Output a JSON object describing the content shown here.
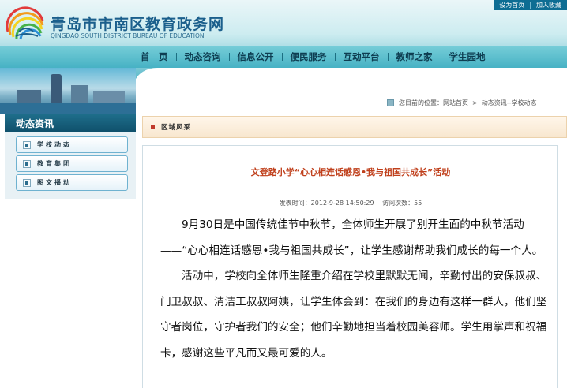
{
  "header": {
    "site_title": "青岛市市南区教育政务网",
    "site_subtitle": "QINGDAO SOUTH DISTRICT BUREAU OF EDUCATION",
    "top_links": [
      "设为首页",
      "加入收藏"
    ]
  },
  "nav": {
    "items": [
      "首　页",
      "动态咨询",
      "信息公开",
      "便民服务",
      "互动平台",
      "教师之家",
      "学生园地"
    ]
  },
  "sidebar": {
    "title": "动态资讯",
    "items": [
      "学校动态",
      "教育集团",
      "图文播动"
    ]
  },
  "breadcrumb": {
    "prefix": "您目前的位置：",
    "home": "网站首页",
    "separator": ">",
    "current": "动态资讯--学校动态"
  },
  "section": {
    "label": "区域风采"
  },
  "article": {
    "title": "文登路小学“心心相连话感恩•我与祖国共成长”活动",
    "published": "发表时间：2012-9-28 14:50:29",
    "views": "访问次数：55",
    "paragraphs": [
      "9月30日是中国传统佳节中秋节，全体师生开展了别开生面的中秋节活动——“心心相连话感恩•我与祖国共成长”，让学生感谢帮助我们成长的每一个人。",
      "活动中，学校向全体师生隆重介绍在学校里默默无闻，辛勤付出的安保叔叔、门卫叔叔、清洁工叔叔阿姨，让学生体会到：在我们的身边有这样一群人，他们坚守者岗位，守护者我们的安全；他们辛勤地担当着校园美容师。学生用掌声和祝福卡，感谢这些平凡而又最可爱的人。"
    ]
  },
  "colors": {
    "header_teal": "#47b2c4",
    "title_blue": "#1b5f8c",
    "article_title_red": "#c0401c",
    "sidebar_dark": "#0f4f6a"
  }
}
